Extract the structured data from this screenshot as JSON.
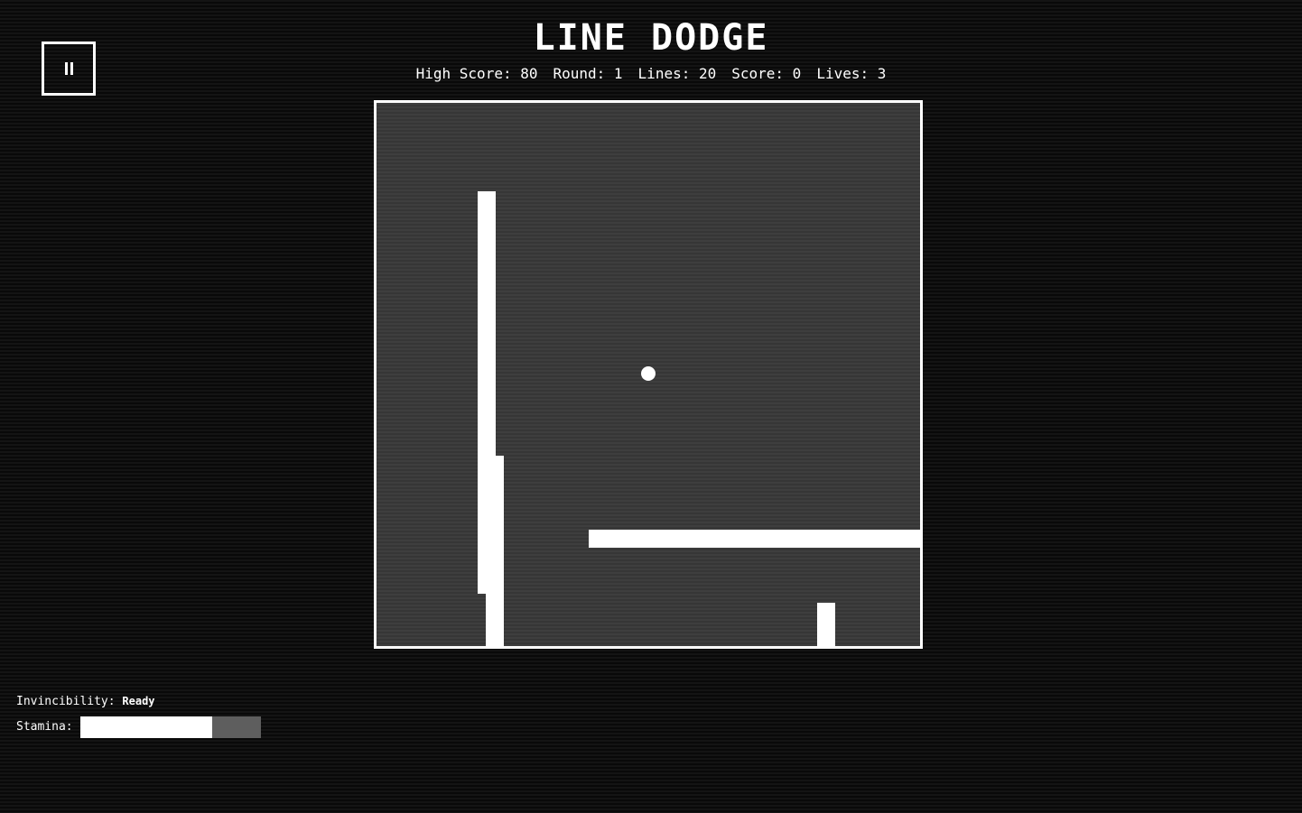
{
  "title": "LINE DODGE",
  "stats": {
    "high_score": "High Score: 80",
    "round": "Round: 1",
    "lines": "Lines: 20",
    "score": "Score: 0",
    "lives": "Lives: 3"
  },
  "hud": {
    "invincibility_label": "Invincibility:",
    "invincibility_value": "Ready",
    "stamina_label": "Stamina:",
    "stamina_level": 0.73
  },
  "icons": {
    "pause": "pause-icon"
  },
  "colors": {
    "foreground": "#ffffff",
    "background": "#0e0e0e",
    "arena": "#3a3a3a",
    "stamina_empty": "#5e5e5e"
  }
}
